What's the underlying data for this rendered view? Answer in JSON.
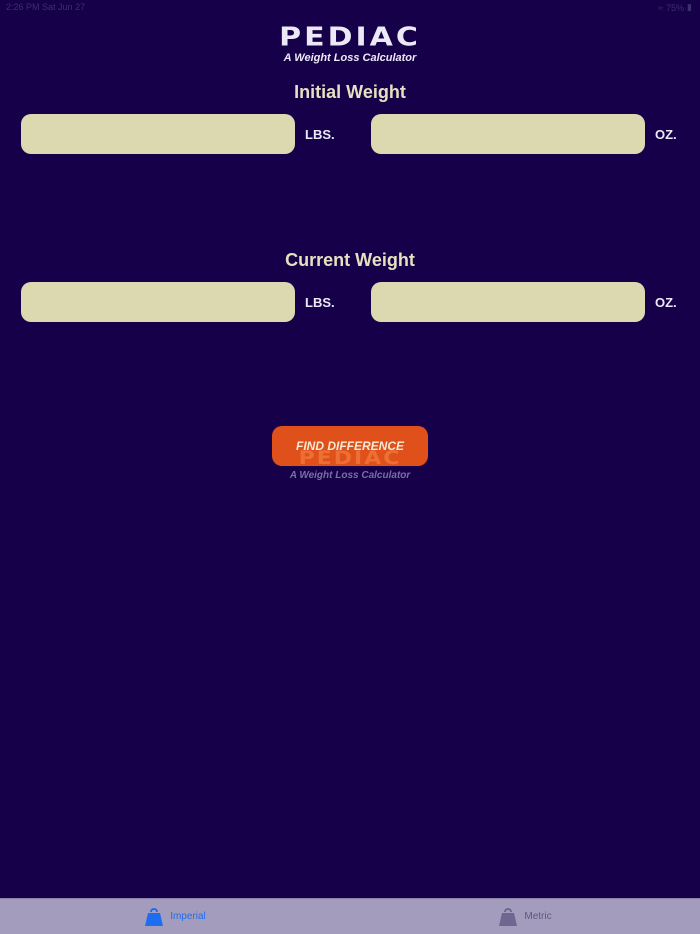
{
  "status_bar": {
    "time": "2:26 PM",
    "date": "Sat Jun 27",
    "battery": "75%"
  },
  "header": {
    "title": "PEDIAC",
    "subtitle": "A Weight Loss Calculator"
  },
  "initial_weight": {
    "title": "Initial Weight",
    "lbs_value": "",
    "lbs_unit": "LBS.",
    "oz_value": "",
    "oz_unit": "OZ."
  },
  "current_weight": {
    "title": "Current Weight",
    "lbs_value": "",
    "lbs_unit": "LBS.",
    "oz_value": "",
    "oz_unit": "OZ."
  },
  "action": {
    "find_label": "FIND DIFFERENCE"
  },
  "watermark": {
    "title": "PEDIAC",
    "subtitle": "A Weight Loss Calculator"
  },
  "tabs": [
    {
      "label": "Imperial",
      "icon": "weight-icon",
      "active": true
    },
    {
      "label": "Metric",
      "icon": "weight-icon",
      "active": false
    }
  ],
  "colors": {
    "background": "#17004a",
    "field": "#dcd9b1",
    "button": "#e0501b",
    "tab_bar": "#a39cbc",
    "active_tab": "#1d6df0"
  }
}
